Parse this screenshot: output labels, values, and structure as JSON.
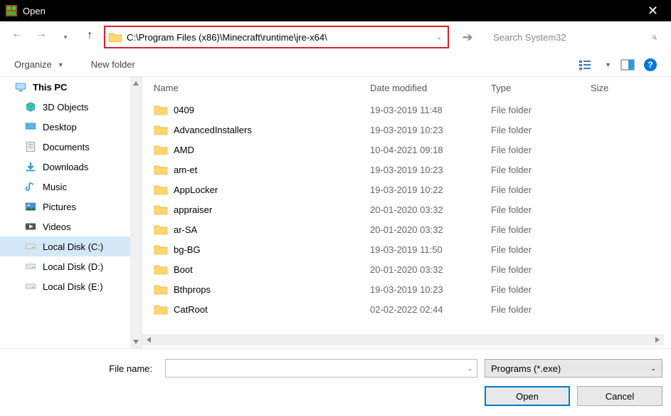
{
  "titlebar": {
    "title": "Open"
  },
  "address": {
    "path": "C:\\Program Files (x86)\\Minecraft\\runtime\\jre-x64\\",
    "highlight_color": "#d82323"
  },
  "search": {
    "placeholder": "Search System32"
  },
  "toolbar": {
    "organize_label": "Organize",
    "newfolder_label": "New folder"
  },
  "tree": {
    "root": "This PC",
    "items": [
      {
        "label": "3D Objects",
        "icon": "objects3d"
      },
      {
        "label": "Desktop",
        "icon": "desktop"
      },
      {
        "label": "Documents",
        "icon": "documents"
      },
      {
        "label": "Downloads",
        "icon": "downloads"
      },
      {
        "label": "Music",
        "icon": "music"
      },
      {
        "label": "Pictures",
        "icon": "pictures"
      },
      {
        "label": "Videos",
        "icon": "videos"
      },
      {
        "label": "Local Disk (C:)",
        "icon": "disk",
        "active": true
      },
      {
        "label": "Local Disk (D:)",
        "icon": "disk"
      },
      {
        "label": "Local Disk (E:)",
        "icon": "disk"
      }
    ]
  },
  "columns": {
    "name": "Name",
    "date": "Date modified",
    "type": "Type",
    "size": "Size"
  },
  "files": [
    {
      "name": "0409",
      "date": "19-03-2019 11:48",
      "type": "File folder"
    },
    {
      "name": "AdvancedInstallers",
      "date": "19-03-2019 10:23",
      "type": "File folder"
    },
    {
      "name": "AMD",
      "date": "10-04-2021 09:18",
      "type": "File folder"
    },
    {
      "name": "am-et",
      "date": "19-03-2019 10:23",
      "type": "File folder"
    },
    {
      "name": "AppLocker",
      "date": "19-03-2019 10:22",
      "type": "File folder"
    },
    {
      "name": "appraiser",
      "date": "20-01-2020 03:32",
      "type": "File folder"
    },
    {
      "name": "ar-SA",
      "date": "20-01-2020 03:32",
      "type": "File folder"
    },
    {
      "name": "bg-BG",
      "date": "19-03-2019 11:50",
      "type": "File folder"
    },
    {
      "name": "Boot",
      "date": "20-01-2020 03:32",
      "type": "File folder"
    },
    {
      "name": "Bthprops",
      "date": "19-03-2019 10:23",
      "type": "File folder"
    },
    {
      "name": "CatRoot",
      "date": "02-02-2022 02:44",
      "type": "File folder"
    }
  ],
  "bottom": {
    "filename_label": "File name:",
    "filter_label": "Programs (*.exe)",
    "open_label": "Open",
    "cancel_label": "Cancel"
  }
}
